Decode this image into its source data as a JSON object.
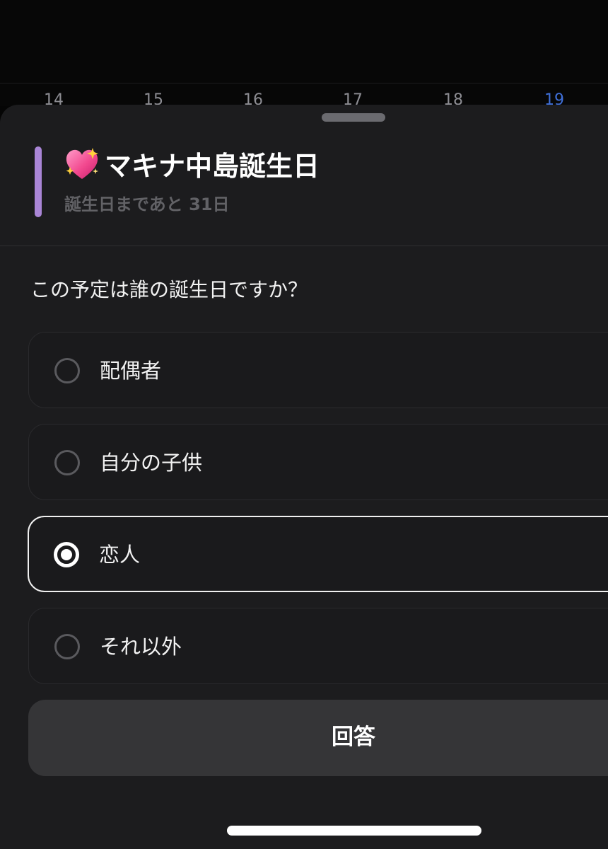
{
  "calendar": {
    "days": [
      "14",
      "15",
      "16",
      "17",
      "18",
      "19"
    ],
    "today": "19",
    "today_color": "#3f6fd8"
  },
  "event": {
    "icon": "sparkling-heart-icon",
    "title": "マキナ中島誕生日",
    "subtitle": "誕生日まであと 31日",
    "accent_color": "#a985d6"
  },
  "question": "この予定は誰の誕生日ですか？",
  "options": [
    {
      "label": "配偶者",
      "selected": false
    },
    {
      "label": "自分の子供",
      "selected": false
    },
    {
      "label": "恋人",
      "selected": true
    },
    {
      "label": "それ以外",
      "selected": false
    }
  ],
  "submit": {
    "label": "回答"
  },
  "colors": {
    "sheet_background": "#1c1c1e",
    "button_background": "#353537"
  }
}
